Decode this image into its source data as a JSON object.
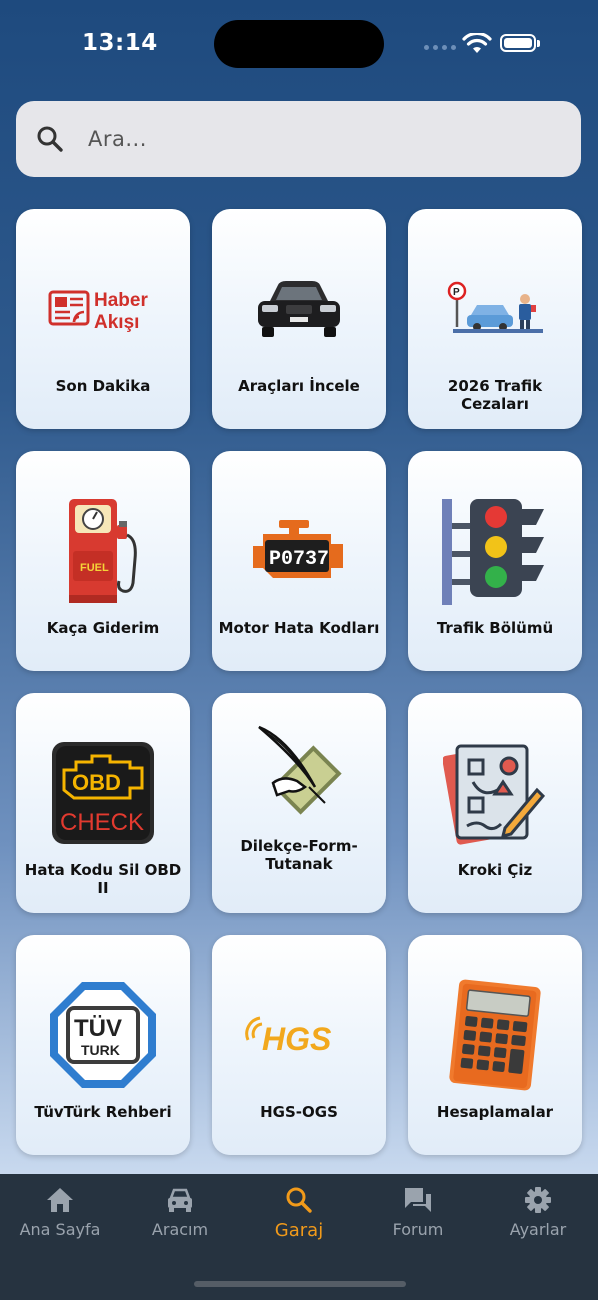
{
  "status": {
    "time": "13:14"
  },
  "search": {
    "placeholder": "Ara..."
  },
  "cards": [
    {
      "label": "Son Dakika",
      "icon": "news-feed-icon",
      "icon_text_1": "Haber",
      "icon_text_2": "Akışı"
    },
    {
      "label": "Araçları İncele",
      "icon": "car-icon"
    },
    {
      "label": "2026 Trafik Cezaları",
      "icon": "traffic-fine-icon"
    },
    {
      "label": "Kaça Giderim",
      "icon": "fuel-pump-icon",
      "icon_text_1": "FUEL"
    },
    {
      "label": "Motor Hata Kodları",
      "icon": "engine-code-icon",
      "icon_text_1": "P0737"
    },
    {
      "label": "Trafik Bölümü",
      "icon": "traffic-light-icon"
    },
    {
      "label": "Hata Kodu Sil OBD II",
      "icon": "obd-check-icon",
      "icon_text_1": "OBD",
      "icon_text_2": "CHECK"
    },
    {
      "label": "Dilekçe-Form-Tutanak",
      "icon": "quill-document-icon"
    },
    {
      "label": "Kroki Çiz",
      "icon": "sketch-document-icon"
    },
    {
      "label": "TüvTürk Rehberi",
      "icon": "tuvturk-icon",
      "icon_text_1": "TÜV",
      "icon_text_2": "TURK"
    },
    {
      "label": "HGS-OGS",
      "icon": "hgs-icon",
      "icon_text_1": "HGS"
    },
    {
      "label": "Hesaplamalar",
      "icon": "calculator-icon"
    }
  ],
  "tabs": [
    {
      "label": "Ana Sayfa",
      "icon": "home-icon",
      "active": false
    },
    {
      "label": "Aracım",
      "icon": "car-icon",
      "active": false
    },
    {
      "label": "Garaj",
      "icon": "search-icon",
      "active": true
    },
    {
      "label": "Forum",
      "icon": "forum-icon",
      "active": false
    },
    {
      "label": "Ayarlar",
      "icon": "gear-icon",
      "active": false
    }
  ],
  "colors": {
    "active_tab": "#f19a1a",
    "tab_bar": "#263340",
    "inactive_tab": "#9aa3ad"
  }
}
